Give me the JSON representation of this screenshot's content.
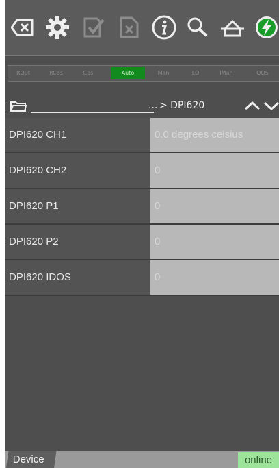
{
  "toolbar": {
    "icons": [
      "clear-icon",
      "settings-gear-icon",
      "check-doc-icon",
      "cancel-doc-icon",
      "info-icon",
      "search-icon",
      "home-icon",
      "power-icon"
    ],
    "colors": {
      "power": "#1a9c2a"
    }
  },
  "modes": {
    "items": [
      "ROut",
      "RCas",
      "Cas",
      "Auto",
      "Man",
      "LO",
      "IMan",
      "OOS"
    ],
    "selected": "Auto"
  },
  "path": {
    "dots": "...",
    "current": "> DPI620"
  },
  "rows": [
    {
      "name": "DPI620 CH1",
      "value": "0.0 degrees celsius"
    },
    {
      "name": "DPI620 CH2",
      "value": "0"
    },
    {
      "name": "DPI620 P1",
      "value": "0"
    },
    {
      "name": "DPI620 P2",
      "value": "0"
    },
    {
      "name": "DPI620 IDOS",
      "value": "0"
    }
  ],
  "bottom": {
    "tab_label": "Device",
    "status": "online"
  }
}
